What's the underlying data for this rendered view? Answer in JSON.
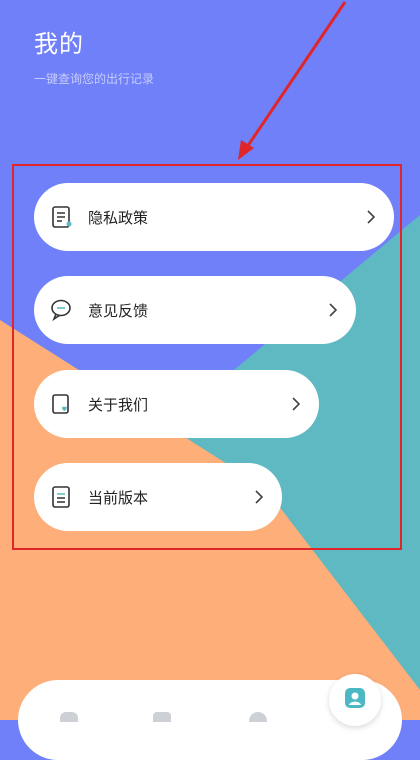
{
  "header": {
    "title": "我的",
    "subtitle": "一键查询您的出行记录"
  },
  "menu": {
    "items": [
      {
        "label": "隐私政策",
        "icon": "document-icon"
      },
      {
        "label": "意见反馈",
        "icon": "chat-bubble-icon"
      },
      {
        "label": "关于我们",
        "icon": "heart-card-icon"
      },
      {
        "label": "当前版本",
        "icon": "version-document-icon"
      }
    ]
  },
  "colors": {
    "background_blue": "#6f80f8",
    "background_teal": "#5fb9c3",
    "background_orange": "#fdae79",
    "highlight_red": "#e1262a",
    "card_white": "#ffffff",
    "fab_icon_teal": "#4cb8c4"
  },
  "bottom_nav": {
    "active_icon": "user-profile-icon"
  }
}
